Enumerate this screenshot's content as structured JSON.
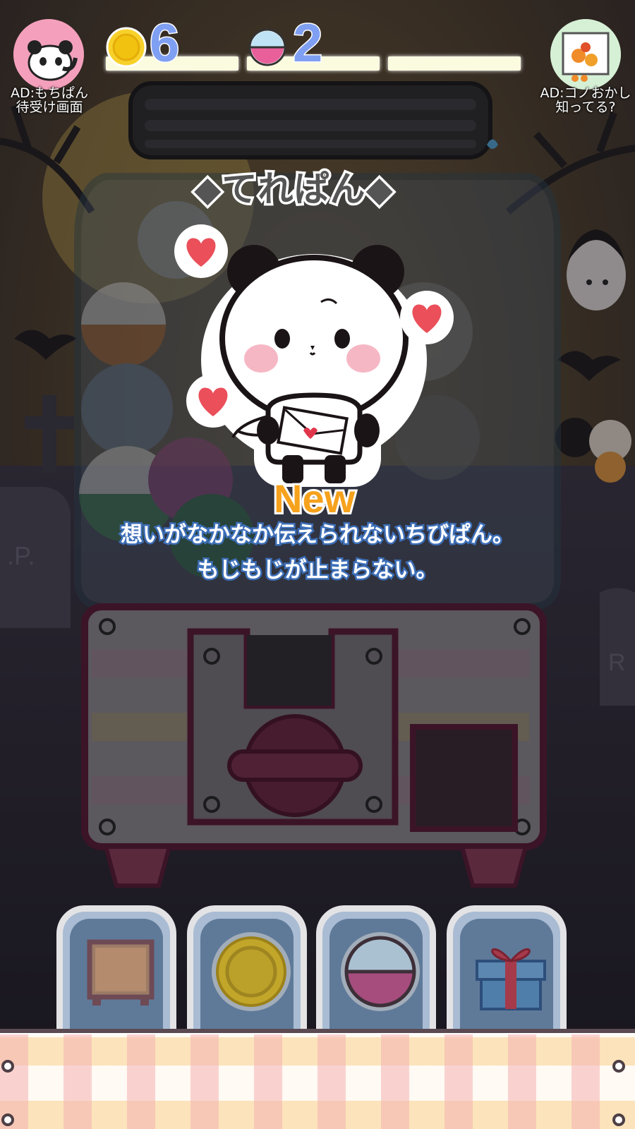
{
  "hud": {
    "ad_left": {
      "line1": "AD:もちぱん",
      "line2": "待受け画面"
    },
    "ad_right": {
      "line1": "AD:コノおかし",
      "line2": "知ってる?"
    },
    "coins": "6",
    "capsules": "2"
  },
  "prize": {
    "name": "◆てれぱん◆",
    "badge": "New",
    "description_line1": "想いがなかなか伝えられないちびぱん。",
    "description_line2": "もじもじが止まらない。"
  },
  "colors": {
    "hud_number": "#7f9ff2",
    "description_outline": "#3d6fb8",
    "new_badge": "#f6a21d",
    "heart": "#ea4f5a"
  },
  "tabs": [
    {
      "icon": "machine-icon"
    },
    {
      "icon": "coin-icon"
    },
    {
      "icon": "capsule-icon"
    },
    {
      "icon": "gift-icon"
    }
  ]
}
